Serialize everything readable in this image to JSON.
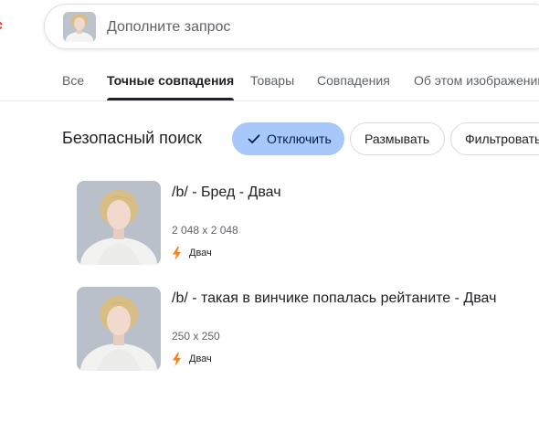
{
  "search": {
    "placeholder": "Дополните запрос"
  },
  "tabs": [
    {
      "label": "Все"
    },
    {
      "label": "Точные совпадения"
    },
    {
      "label": "Товары"
    },
    {
      "label": "Совпадения"
    },
    {
      "label": "Об этом изображении"
    }
  ],
  "safe_search": {
    "label": "Безопасный поиск",
    "options": [
      {
        "label": "Отключить",
        "selected": true
      },
      {
        "label": "Размывать",
        "selected": false
      },
      {
        "label": "Фильтровать",
        "selected": false
      }
    ]
  },
  "results": [
    {
      "title": "/b/ - Бред - Двач",
      "size": "2 048 x 2 048",
      "source": "Двач"
    },
    {
      "title": "/b/ - такая в винчике попалась рейтаните - Двач",
      "size": "250 x 250",
      "source": "Двач"
    }
  ],
  "colors": {
    "chip_selected_bg": "#a8c7fa",
    "source_icon": "#f5821f",
    "logo_fragment": "#ea4335"
  }
}
